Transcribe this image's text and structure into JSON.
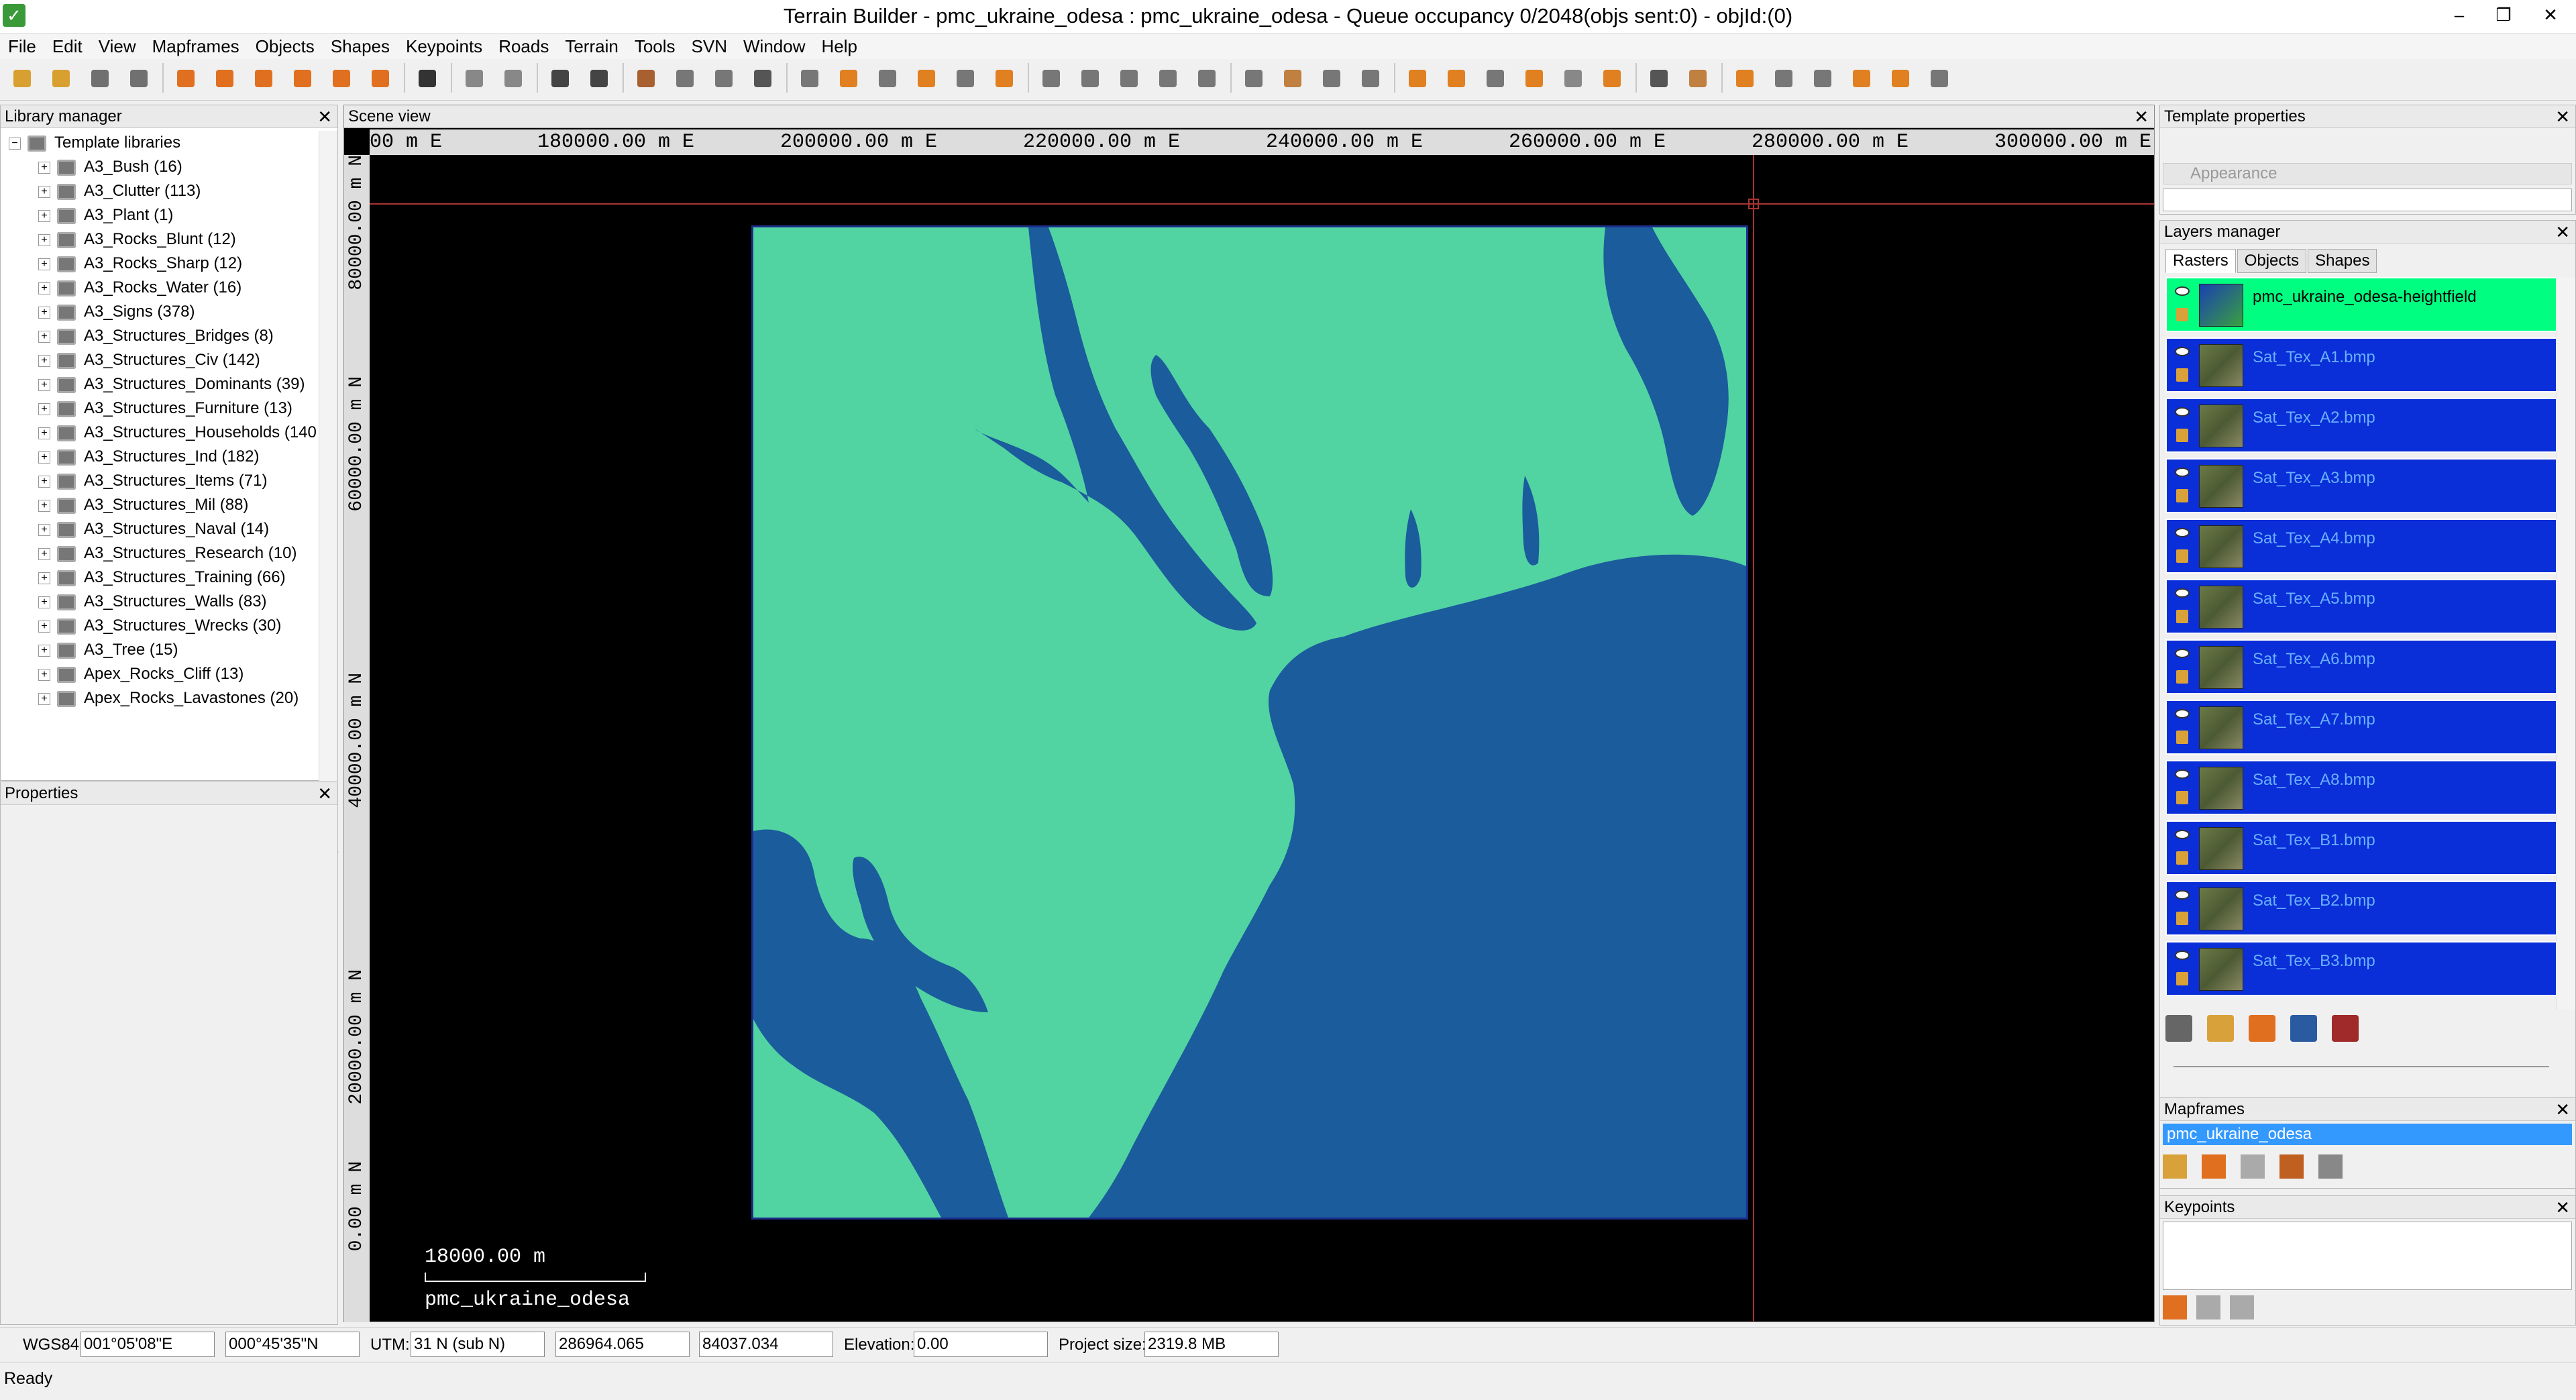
{
  "window": {
    "title": "Terrain Builder - pmc_ukraine_odesa : pmc_ukraine_odesa - Queue occupancy 0/2048(objs sent:0) - objId:(0)",
    "controls": [
      "–",
      "❐",
      "✕"
    ]
  },
  "menu": [
    "File",
    "Edit",
    "View",
    "Mapframes",
    "Objects",
    "Shapes",
    "Keypoints",
    "Roads",
    "Terrain",
    "Tools",
    "SVN",
    "Window",
    "Help"
  ],
  "library_manager": {
    "title": "Library manager",
    "root": "Template libraries",
    "items": [
      "A3_Bush (16)",
      "A3_Clutter (113)",
      "A3_Plant (1)",
      "A3_Rocks_Blunt (12)",
      "A3_Rocks_Sharp (12)",
      "A3_Rocks_Water (16)",
      "A3_Signs (378)",
      "A3_Structures_Bridges (8)",
      "A3_Structures_Civ (142)",
      "A3_Structures_Dominants (39)",
      "A3_Structures_Furniture (13)",
      "A3_Structures_Households (140",
      "A3_Structures_Ind (182)",
      "A3_Structures_Items (71)",
      "A3_Structures_Mil (88)",
      "A3_Structures_Naval (14)",
      "A3_Structures_Research (10)",
      "A3_Structures_Training (66)",
      "A3_Structures_Walls (83)",
      "A3_Structures_Wrecks (30)",
      "A3_Tree (15)",
      "Apex_Rocks_Cliff (13)",
      "Apex_Rocks_Lavastones (20)"
    ]
  },
  "properties": {
    "title": "Properties"
  },
  "scene": {
    "title": "Scene view",
    "x_ticks": [
      "00 m E",
      "180000.00 m E",
      "200000.00 m E",
      "220000.00 m E",
      "240000.00 m E",
      "260000.00 m E",
      "280000.00 m E",
      "300000.00 m E"
    ],
    "y_ticks": [
      "80000.00 m N",
      "60000.00 m N",
      "40000.00 m N",
      "20000.00 m N",
      "0.00 m N"
    ],
    "scale_label": "18000.00 m",
    "map_label": "pmc_ukraine_odesa",
    "colors": {
      "land": "#52d4a2",
      "water": "#1a5c9c"
    }
  },
  "template_properties": {
    "title": "Template properties",
    "section": "Appearance"
  },
  "layers_manager": {
    "title": "Layers manager",
    "tabs": [
      "Rasters",
      "Objects",
      "Shapes"
    ],
    "layers": [
      "pmc_ukraine_odesa-heightfield",
      "Sat_Tex_A1.bmp",
      "Sat_Tex_A2.bmp",
      "Sat_Tex_A3.bmp",
      "Sat_Tex_A4.bmp",
      "Sat_Tex_A5.bmp",
      "Sat_Tex_A6.bmp",
      "Sat_Tex_A7.bmp",
      "Sat_Tex_A8.bmp",
      "Sat_Tex_B1.bmp",
      "Sat_Tex_B2.bmp",
      "Sat_Tex_B3.bmp"
    ]
  },
  "mapframes": {
    "title": "Mapframes",
    "items": [
      "pmc_ukraine_odesa"
    ]
  },
  "keypoints": {
    "title": "Keypoints"
  },
  "status": {
    "wgs_label": "WGS84:",
    "lon": "001°05'08\"E",
    "lat": "000°45'35\"N",
    "utm_label": "UTM:",
    "zone": "31 N  (sub N)",
    "easting": "286964.065",
    "northing": "84037.034",
    "elev_label": "Elevation:",
    "elevation": "0.00",
    "size_label": "Project size:",
    "size": "2319.8 MB",
    "ready": "Ready"
  }
}
